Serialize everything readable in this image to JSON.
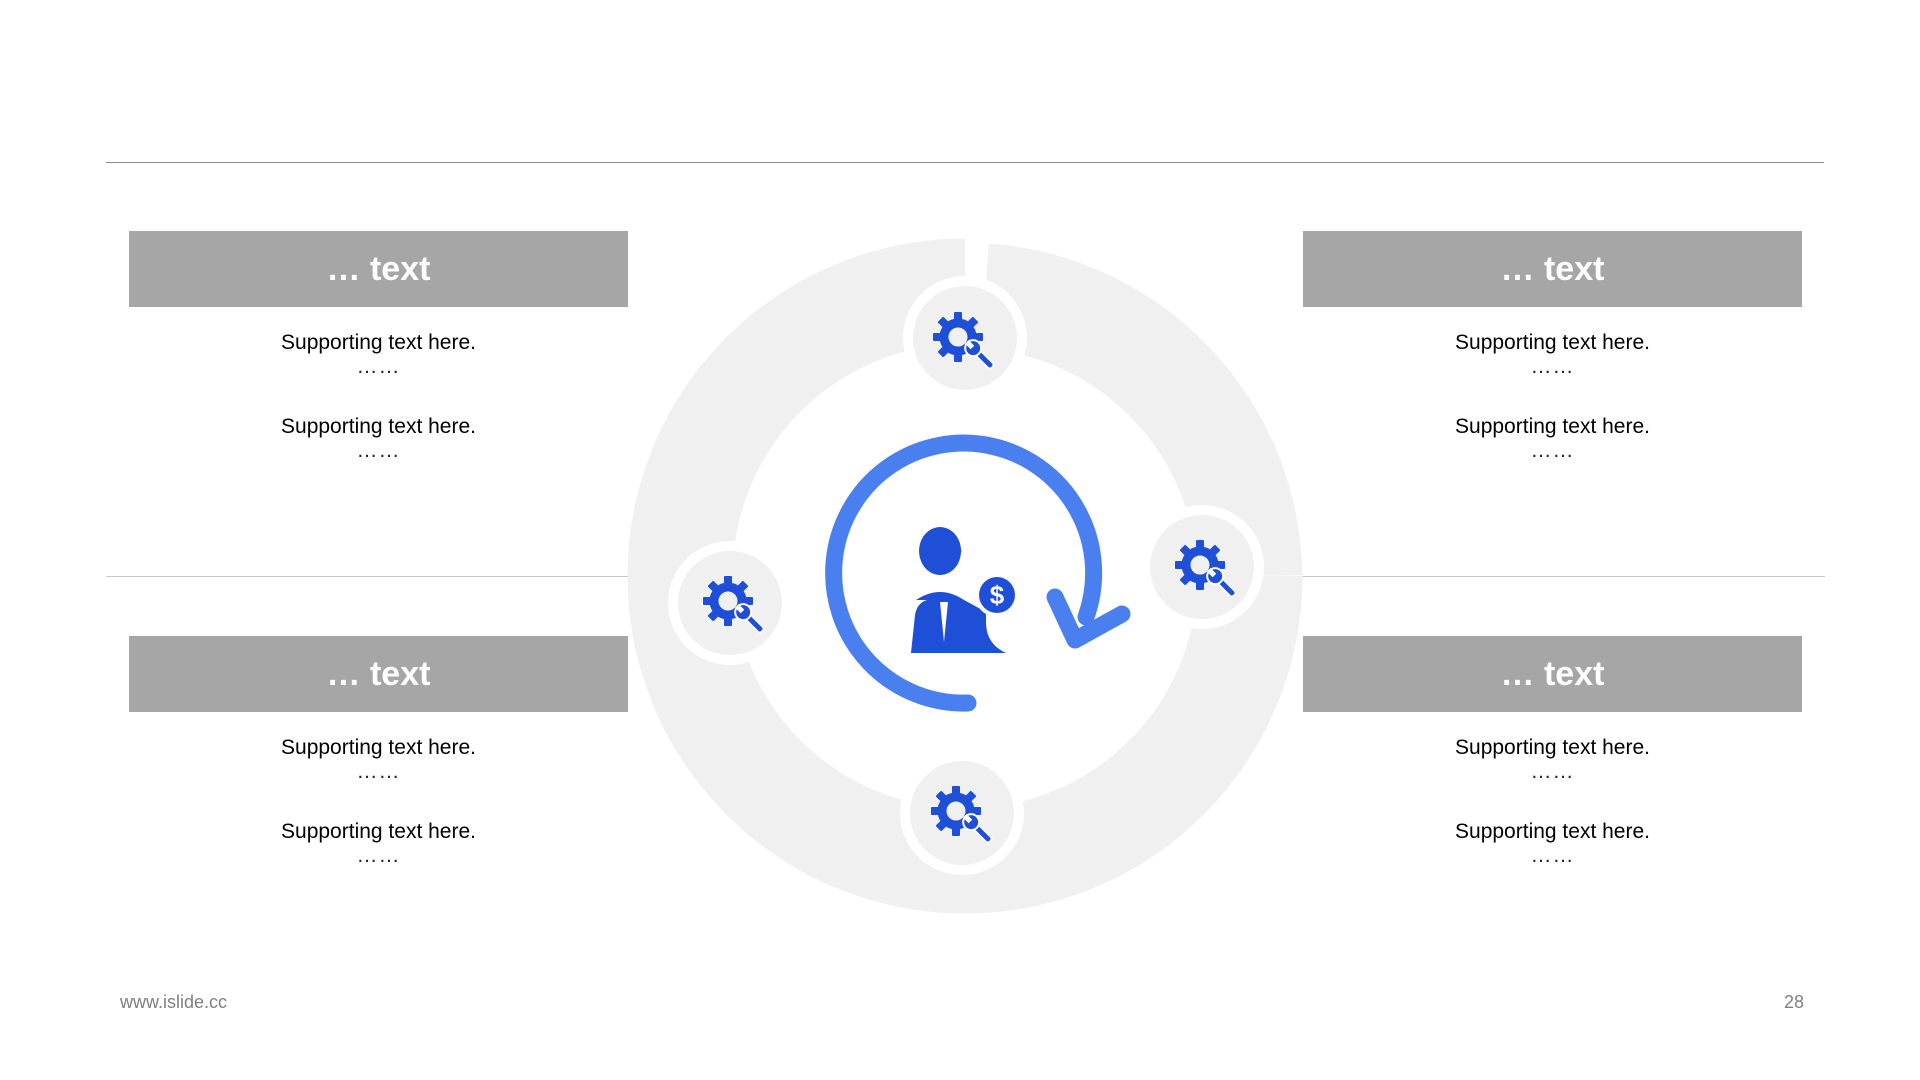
{
  "cards": {
    "top_left": {
      "title": "… text",
      "items": [
        {
          "text": "Supporting text here.",
          "dots": "……"
        },
        {
          "text": "Supporting text here.",
          "dots": "……"
        }
      ]
    },
    "top_right": {
      "title": "… text",
      "items": [
        {
          "text": "Supporting text here.",
          "dots": "……"
        },
        {
          "text": "Supporting text here.",
          "dots": "……"
        }
      ]
    },
    "bottom_left": {
      "title": "… text",
      "items": [
        {
          "text": "Supporting text here.",
          "dots": "……"
        },
        {
          "text": "Supporting text here.",
          "dots": "……"
        }
      ]
    },
    "bottom_right": {
      "title": "… text",
      "items": [
        {
          "text": "Supporting text here.",
          "dots": "……"
        },
        {
          "text": "Supporting text here.",
          "dots": "……"
        }
      ]
    }
  },
  "footer": {
    "url": "www.islide.cc",
    "page_number": "28"
  },
  "icons": {
    "center": "businessman-dollar-icon",
    "cycle": "circular-arrow-icon",
    "nodes": [
      "gear-wrench-icon",
      "gear-wrench-icon",
      "gear-wrench-icon",
      "gear-wrench-icon"
    ]
  },
  "colors": {
    "header_bg": "#a6a6a6",
    "ring": "#f0f0f0",
    "accent_blue": "#4a7ff0",
    "icon_blue": "#1f4fd6"
  }
}
